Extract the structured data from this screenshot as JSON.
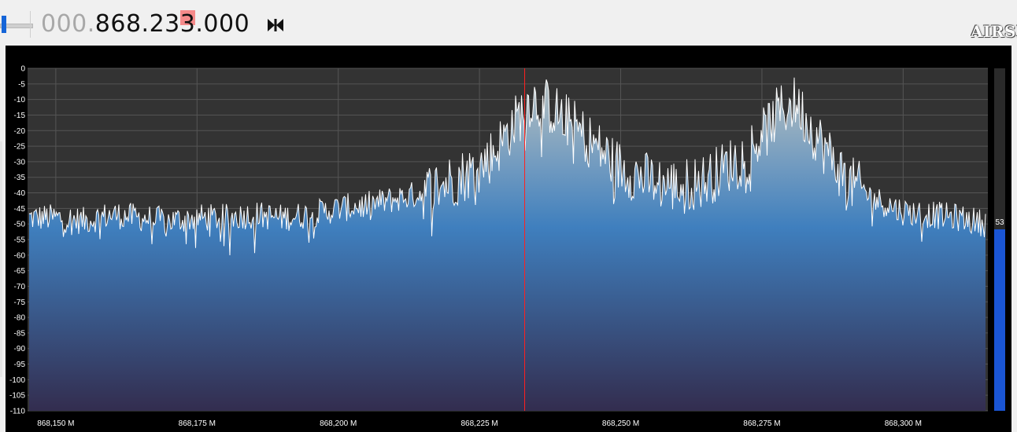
{
  "toolbar": {
    "volume_level": 0.05,
    "frequency": {
      "leading_zeros": "000.",
      "digits_main": "868.23",
      "digit_highlighted": "3",
      "digits_tail": ".000"
    },
    "swap_icon": "bowtie-icon",
    "logo_text": "AIRSPY"
  },
  "chart_data": {
    "type": "line",
    "title": "",
    "xlabel": "",
    "ylabel": "",
    "x_unit": "MHz",
    "xlim": [
      868.145,
      868.315
    ],
    "ylim": [
      -110,
      0
    ],
    "grid": true,
    "y_ticks": [
      0,
      -5,
      -10,
      -15,
      -20,
      -25,
      -30,
      -35,
      -40,
      -45,
      -50,
      -55,
      -60,
      -65,
      -70,
      -75,
      -80,
      -85,
      -90,
      -95,
      -100,
      -105,
      -110
    ],
    "y_tick_labels": [
      "0",
      "-5",
      "-10",
      "-15",
      "-20",
      "-25",
      "-30",
      "-35",
      "-40",
      "-45",
      "-50",
      "-55",
      "-60",
      "-65",
      "-70",
      "-75",
      "-80",
      "-85",
      "-90",
      "-95",
      "-100",
      "-105",
      "-110"
    ],
    "x_ticks": [
      868.15,
      868.175,
      868.2,
      868.225,
      868.25,
      868.275,
      868.3
    ],
    "x_tick_labels": [
      "868,150 M",
      "868,175 M",
      "868,200 M",
      "868,225 M",
      "868,250 M",
      "868,275 M",
      "868,300 M"
    ],
    "center_frequency": 868.233,
    "series": [
      {
        "x": [
          868.145,
          868.15,
          868.155,
          868.16,
          868.165,
          868.17,
          868.175,
          868.18,
          868.185,
          868.19,
          868.195,
          868.2,
          868.205,
          868.21,
          868.215,
          868.22,
          868.225,
          868.228,
          868.231,
          868.234,
          868.237,
          868.24,
          868.245,
          868.25,
          868.255,
          868.26,
          868.265,
          868.27,
          868.275,
          868.278,
          868.281,
          868.284,
          868.287,
          868.29,
          868.295,
          868.3,
          868.305,
          868.31,
          868.315
        ],
        "y": [
          -48,
          -48,
          -49,
          -47,
          -48,
          -49,
          -48,
          -48,
          -47,
          -48,
          -47,
          -45,
          -44,
          -42,
          -40,
          -36,
          -32,
          -26,
          -18,
          -10,
          -12,
          -16,
          -24,
          -32,
          -36,
          -38,
          -36,
          -30,
          -22,
          -14,
          -11,
          -20,
          -28,
          -36,
          -42,
          -46,
          -47,
          -48,
          -50
        ]
      }
    ],
    "level_indicator": {
      "value": 53,
      "label": "53",
      "fraction": 0.53
    },
    "colors": {
      "background": "#000000",
      "plot_background": "#333333",
      "grid": "#555555",
      "trace": "#ffffff",
      "fill_top": "#b9c2c2",
      "fill_mid": "#3f7fbe",
      "fill_bottom": "#332d4f",
      "center_marker": "#ff2020",
      "level_bar": "#1a55d4",
      "axis_text": "#ffffff"
    }
  }
}
